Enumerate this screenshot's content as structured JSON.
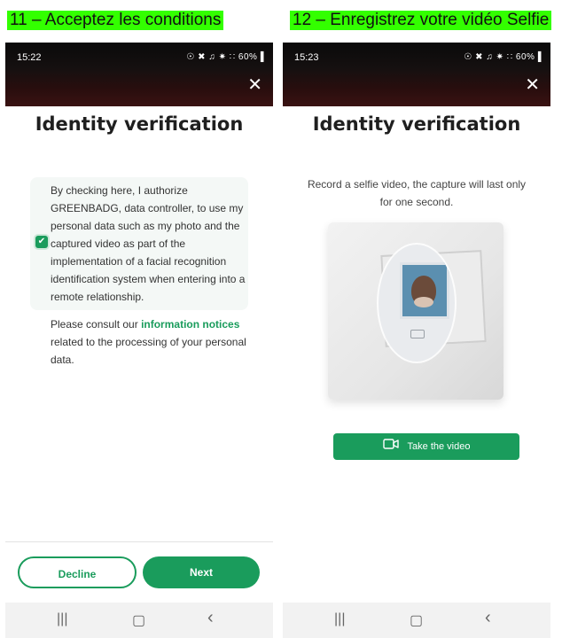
{
  "left": {
    "step_label": "11 – Acceptez les conditions",
    "status": {
      "time": "15:22",
      "icons": "☉ ✖ ♫ ✷ ∷ 60%▐"
    },
    "title": "Identity verification",
    "consent_text": "By checking here, I authorize GREENBADG, data controller, to use my personal data such as my photo and the captured video as part of the implementation of a facial recognition identification system when entering into a remote relationship.",
    "consent_checked": true,
    "notice_prefix": "Please consult our ",
    "notice_link": "information notices",
    "notice_suffix": " related to the processing of your personal data.",
    "decline_label": "Decline",
    "next_label": "Next"
  },
  "right": {
    "step_label": "12 – Enregistrez votre vidéo Selfie",
    "status": {
      "time": "15:23",
      "icons": "☉ ✖ ♫ ✷ ∷ 60%▐"
    },
    "title": "Identity verification",
    "description": "Record a selfie video, the capture will last only for one second.",
    "take_video_label": "Take the video"
  },
  "nav": {
    "recents": "|||",
    "home": "▢",
    "back": "‹"
  },
  "colors": {
    "accent": "#1a9c5c",
    "label_bg": "#33ff00"
  },
  "icons": [
    "close-icon",
    "checkbox-checked-icon",
    "video-camera-icon",
    "recents-icon",
    "home-icon",
    "back-icon"
  ]
}
